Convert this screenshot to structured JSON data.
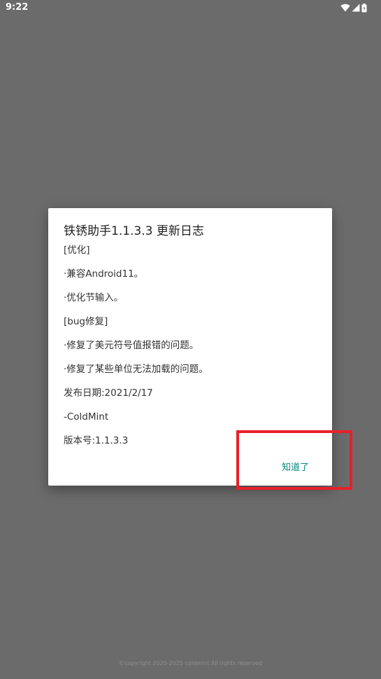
{
  "status_bar": {
    "time": "9:22",
    "icons": [
      "wifi-icon",
      "signal-icon",
      "battery-icon"
    ]
  },
  "dialog": {
    "title": "铁锈助手1.1.3.3 更新日志",
    "lines": [
      "[优化]",
      "·兼容Android11。",
      "·优化节输入。",
      "[bug修复]",
      "·修复了美元符号值报错的问题。",
      "·修复了某些单位无法加载的问题。",
      "发布日期:2021/2/17",
      "-ColdMint",
      "版本号:1.1.3.3"
    ],
    "confirm_label": "知道了"
  },
  "footer": {
    "copyright": "©copyright 2020-2025 coldmint All rights reserved"
  },
  "colors": {
    "overlay_bg": "#6b6b6b",
    "dialog_bg": "#ffffff",
    "accent": "#00897b",
    "highlight": "#e8202b"
  }
}
